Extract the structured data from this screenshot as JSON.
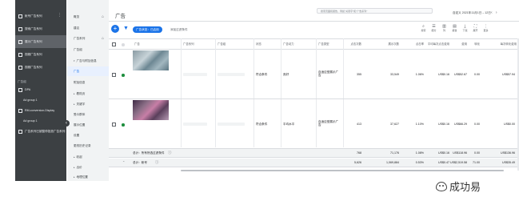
{
  "left_panel": {
    "items": [
      {
        "label": "帐号广告系列",
        "selected": false
      },
      {
        "label": "搜索广告系列",
        "selected": false
      },
      {
        "label": "展示广告系列",
        "selected": true
      },
      {
        "label": "视频广告系列",
        "selected": false
      },
      {
        "label": "视频广告系列",
        "selected": false
      }
    ],
    "section_label": "广告组",
    "sub_items": [
      {
        "label": "DPA"
      },
      {
        "label": "Ad group 1"
      },
      {
        "label": "RM-conversion-Display"
      },
      {
        "label": "Ad group 1"
      },
      {
        "label": "广告系列已被暂停投放广告系列"
      }
    ]
  },
  "nav": {
    "items": [
      {
        "label": "概览",
        "selected": false,
        "home": true,
        "expander": false
      },
      {
        "label": "建议",
        "selected": false,
        "home": false,
        "expander": false
      },
      {
        "label": "广告系列",
        "selected": false,
        "home": true,
        "expander": false
      },
      {
        "label": "广告组",
        "selected": false,
        "home": false,
        "expander": false
      },
      {
        "label": "广告与附加信息",
        "selected": false,
        "home": false,
        "expander": true
      },
      {
        "label": "广告",
        "selected": true,
        "home": false,
        "expander": false
      },
      {
        "label": "附加信息",
        "selected": false,
        "home": false,
        "expander": false
      },
      {
        "label": "着陆页",
        "selected": false,
        "home": false,
        "expander": true
      },
      {
        "label": "关键字",
        "selected": false,
        "home": false,
        "expander": true
      },
      {
        "label": "受众群体",
        "selected": false,
        "home": false,
        "expander": false
      },
      {
        "label": "展示位置",
        "selected": false,
        "home": false,
        "expander": false
      },
      {
        "label": "设置",
        "selected": false,
        "home": false,
        "expander": false
      },
      {
        "label": "更改历史记录",
        "selected": false,
        "home": false,
        "expander": false
      },
      {
        "label": "收起",
        "selected": false,
        "home": false,
        "expander": false
      },
      {
        "label": "出价",
        "selected": false,
        "home": false,
        "expander": true
      },
      {
        "label": "地理位置",
        "selected": false,
        "home": false,
        "expander": true
      }
    ]
  },
  "header": {
    "title": "广告",
    "search_placeholder": "搜索页面和报告，例如\"关键字\"和\"广告系列\"",
    "date_range": "自定义  2021年11月1日 – 12日",
    "prev_icon": "chevron-left-icon",
    "next_icon": "chevron-right-icon"
  },
  "toolbar": {
    "filter_chip": "广告状态：已启用",
    "add_filter": "添加过滤条件",
    "tools": [
      {
        "label": "搜索",
        "icon": "search-icon"
      },
      {
        "label": "细分",
        "icon": "segment-icon"
      },
      {
        "label": "列",
        "icon": "columns-icon"
      },
      {
        "label": "报告",
        "icon": "report-icon"
      },
      {
        "label": "下载",
        "icon": "download-icon"
      },
      {
        "label": "展开",
        "icon": "expand-icon"
      },
      {
        "label": "更多",
        "icon": "more-icon"
      }
    ]
  },
  "table": {
    "headers": [
      "广告",
      "广告系列",
      "广告组",
      "状态",
      "广告动力",
      "广告类型",
      "点击次数",
      "展示次数",
      "点击率",
      "平均每次点击费用",
      "费用",
      "转化",
      "每次转化费用"
    ],
    "rows": [
      {
        "campaign": "",
        "ad_group": "",
        "status": "符合条件",
        "strength": "良好",
        "type": "自适应型展示广告",
        "clicks": "355",
        "impressions": "33,549",
        "ctr": "1.06%",
        "avg_cpc": "US$0.16",
        "cost": "US$52.67",
        "conversions": "0.00",
        "cost_per_conv": "US$57.94"
      },
      {
        "campaign": "",
        "ad_group": "",
        "status": "符合条件",
        "strength": "平均水平",
        "type": "自适应型展示广告",
        "clicks": "413",
        "impressions": "37,627",
        "ctr": "1.10%",
        "avg_cpc": "US$0.16",
        "cost": "US$66.29",
        "conversions": "0.00",
        "cost_per_conv": "US$0.00"
      }
    ],
    "totals": [
      {
        "label": "总计：所有所选过滤条件",
        "clicks": "768",
        "impressions": "71,176",
        "ctr": "1.08%",
        "avg_cpc": "US$0.16",
        "cost": "US$118.96",
        "conversions": "0.00",
        "cost_per_conv": "US$136.96"
      },
      {
        "label": "总计：帐号",
        "clicks": "5,626",
        "impressions": "1,069,884",
        "ctr": "0.53%",
        "avg_cpc": "US$0.47",
        "cost": "US$2,519.58",
        "conversions": "71.00",
        "cost_per_conv": "US$35.49"
      }
    ]
  },
  "watermark": {
    "text": "成功易",
    "icon": "wechat-icon"
  },
  "colors": {
    "accent": "#1a73e8",
    "enabled": "#1e8e3e",
    "sidebar": "#3c4043"
  }
}
